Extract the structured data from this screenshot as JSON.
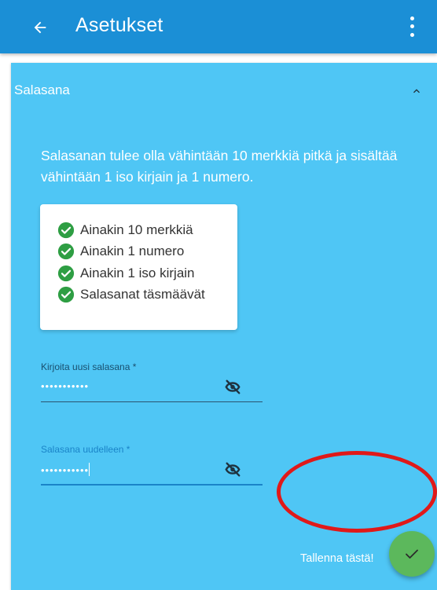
{
  "appbar": {
    "back_icon": "arrow-left-icon",
    "title": "Asetukset",
    "menu_icon": "more-vertical-icon"
  },
  "section": {
    "title": "Salasana",
    "collapse_icon": "chevron-up-icon",
    "rule_text": "Salasanan tulee olla vähintään 10 merkkiä pitkä ja sisältää vähintään 1 iso kirjain ja 1 numero.",
    "checklist": [
      {
        "label": "Ainakin 10 merkkiä",
        "icon": "check-circle-icon",
        "color": "#2e9e43"
      },
      {
        "label": "Ainakin 1 numero",
        "icon": "check-circle-icon",
        "color": "#2e9e43"
      },
      {
        "label": "Ainakin 1 iso kirjain",
        "icon": "check-circle-icon",
        "color": "#2e9e43"
      },
      {
        "label": "Salasanat täsmäävät",
        "icon": "check-circle-icon",
        "color": "#2e9e43"
      }
    ]
  },
  "fields": {
    "new_password": {
      "label": "Kirjoita uusi salasana *",
      "value": "•••••••••••",
      "icon": "eye-off-icon"
    },
    "confirm_password": {
      "label": "Salasana uudelleen *",
      "value": "•••••••••••",
      "icon": "eye-off-icon",
      "focused": true
    }
  },
  "save": {
    "hint": "Tallenna tästä!",
    "icon": "check-icon",
    "fab_color": "#5cb85c"
  },
  "colors": {
    "appbar": "#1b8fd6",
    "panel": "#4fc6f5",
    "annotation": "#e01919"
  }
}
